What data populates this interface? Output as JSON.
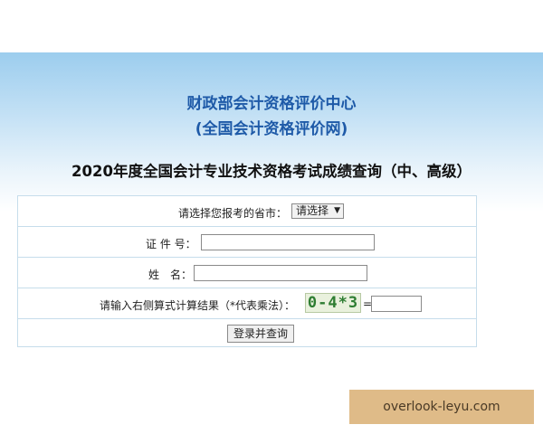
{
  "header": {
    "org_name": "财政部会计资格评价中心",
    "org_site": "(全国会计资格评价网)",
    "page_title": "2020年度全国会计专业技术资格考试成绩查询（中、高级）"
  },
  "form": {
    "province_label": "请选择您报考的省市：",
    "province_selected": "请选择",
    "id_label": "证 件 号：",
    "id_value": "",
    "name_label": "姓　名：",
    "name_value": "",
    "captcha_label": "请输入右侧算式计算结果（*代表乘法）：",
    "captcha_text": "0-4*3",
    "equals": "=",
    "captcha_value": "",
    "submit_label": "登录并查询"
  },
  "watermark": {
    "text": "overlook-leyu.com"
  },
  "colors": {
    "title_blue": "#1e5aa8",
    "border": "#c6ddeb",
    "captcha_green": "#2e7d32"
  }
}
